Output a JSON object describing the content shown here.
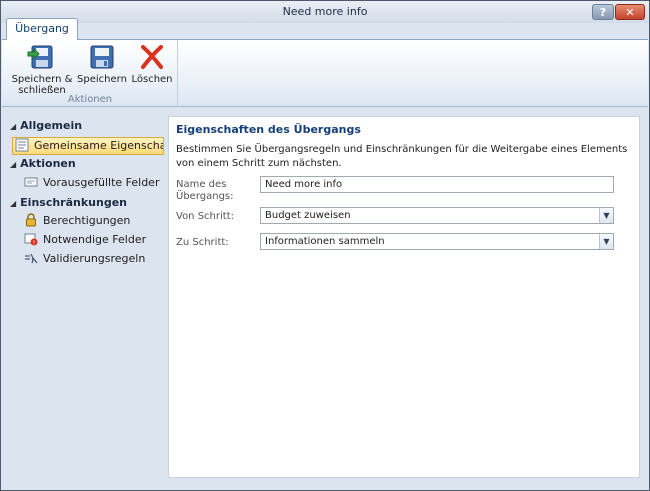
{
  "window": {
    "title": "Need more info",
    "help_label": "?",
    "close_label": "✕"
  },
  "ribbon": {
    "tab_label": "Übergang",
    "buttons": [
      {
        "label_line1": "Speichern &",
        "label_line2": "schließen",
        "icon": "save-close-icon"
      },
      {
        "label": "Speichern",
        "icon": "save-icon"
      },
      {
        "label": "Löschen",
        "icon": "delete-icon"
      }
    ],
    "group_label": "Aktionen"
  },
  "sidebar": {
    "sections": [
      {
        "title": "Allgemein",
        "items": [
          {
            "label": "Gemeinsame Eigenscha...",
            "icon": "properties-icon",
            "selected": true
          }
        ]
      },
      {
        "title": "Aktionen",
        "items": [
          {
            "label": "Vorausgefüllte Felder",
            "icon": "form-fields-icon"
          }
        ]
      },
      {
        "title": "Einschränkungen",
        "items": [
          {
            "label": "Berechtigungen",
            "icon": "lock-icon"
          },
          {
            "label": "Notwendige Felder",
            "icon": "required-fields-icon"
          },
          {
            "label": "Validierungsregeln",
            "icon": "validation-rules-icon"
          }
        ]
      }
    ]
  },
  "panel": {
    "title": "Eigenschaften des Übergangs",
    "description": "Bestimmen Sie Übergangsregeln und Einschränkungen für die Weitergabe eines Elements von einem Schritt zum nächsten.",
    "fields": [
      {
        "label_line1": "Name des",
        "label_line2": "Übergangs:",
        "value": "Need more info"
      },
      {
        "label": "Von Schritt:",
        "value": "Budget zuweisen"
      },
      {
        "label": "Zu Schritt:",
        "value": "Informationen sammeln"
      }
    ]
  },
  "colors": {
    "accent_title": "#173f7a",
    "selected_bg": "#ffd978",
    "delete_red": "#d9321e"
  }
}
